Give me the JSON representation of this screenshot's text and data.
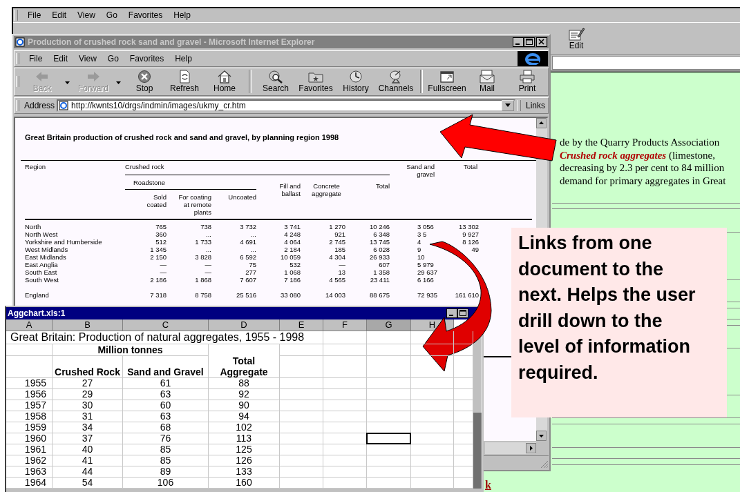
{
  "background_browser": {
    "menu": [
      {
        "label": "File"
      },
      {
        "label": "Edit"
      },
      {
        "label": "View"
      },
      {
        "label": "Go"
      },
      {
        "label": "Favorites"
      },
      {
        "label": "Help"
      }
    ],
    "toolbar": [
      {
        "label": "Edit",
        "kind": "edit"
      }
    ],
    "page_lines": [
      {
        "text": "de by the Quarry Products Association"
      },
      {
        "emphasis": "Crushed rock aggregates",
        "text": "(limestone,"
      },
      {
        "text": "decreasing by 2.3 per cent to 84 million"
      },
      {
        "text": "demand for primary aggregates in Great"
      }
    ],
    "link_fragment": "k"
  },
  "browser": {
    "title": "Production of crushed rock sand and gravel - Microsoft Internet Explorer",
    "active": false,
    "menu": [
      {
        "label": "File"
      },
      {
        "label": "Edit"
      },
      {
        "label": "View"
      },
      {
        "label": "Go"
      },
      {
        "label": "Favorites"
      },
      {
        "label": "Help"
      }
    ],
    "toolbar": [
      {
        "label": "Back",
        "kind": "back",
        "disabled": true,
        "dropdown": true,
        "separator_after": false
      },
      {
        "label": "Forward",
        "kind": "forward",
        "disabled": true,
        "dropdown": true,
        "separator_after": false
      },
      {
        "label": "Stop",
        "kind": "stop",
        "disabled": false,
        "dropdown": false,
        "separator_after": false
      },
      {
        "label": "Refresh",
        "kind": "refresh",
        "disabled": false,
        "dropdown": false,
        "separator_after": false
      },
      {
        "label": "Home",
        "kind": "home",
        "disabled": false,
        "dropdown": false,
        "separator_after": true
      },
      {
        "label": "Search",
        "kind": "search",
        "disabled": false,
        "dropdown": false,
        "separator_after": false
      },
      {
        "label": "Favorites",
        "kind": "favorites",
        "disabled": false,
        "dropdown": false,
        "separator_after": false
      },
      {
        "label": "History",
        "kind": "history",
        "disabled": false,
        "dropdown": false,
        "separator_after": false
      },
      {
        "label": "Channels",
        "kind": "channels",
        "disabled": false,
        "dropdown": false,
        "separator_after": true
      },
      {
        "label": "Fullscreen",
        "kind": "fullscreen",
        "disabled": false,
        "dropdown": false,
        "separator_after": false
      },
      {
        "label": "Mail",
        "kind": "mail",
        "disabled": false,
        "dropdown": false,
        "separator_after": false
      },
      {
        "label": "Print",
        "kind": "print",
        "disabled": false,
        "dropdown": false,
        "separator_after": false
      }
    ],
    "address_label": "Address",
    "url": "http://kwnts10/drgs/indmin/images/ukmy_cr.htm",
    "links_label": "Links",
    "table": {
      "heading": "Great Britain production of crushed rock and sand and gravel, by planning region 1998",
      "headers": {
        "region": "Region",
        "crushed_rock": "Crushed rock",
        "roadstone": "Roadstone",
        "sold_coated": "Sold coated",
        "for_coating": "For coating at remote plants",
        "uncoated": "Uncoated",
        "fill": "Fill and ballast",
        "concrete": "Concrete aggregate",
        "crushed_total": "Total",
        "sand": "Sand and gravel",
        "total": "Total"
      },
      "rows": [
        {
          "kind": "region",
          "region": "North",
          "values": [
            "765",
            "738",
            "3 732",
            "3 741",
            "1 270",
            "10 246",
            "3 056",
            "13 302"
          ]
        },
        {
          "kind": "region",
          "region": "North West",
          "values": [
            "360",
            "...",
            "...",
            "4 248",
            "921",
            "6 348",
            "3 5",
            "9 927"
          ]
        },
        {
          "kind": "region",
          "region": "Yorkshire and Humberside",
          "values": [
            "512",
            "1 733",
            "4 691",
            "4 064",
            "2 745",
            "13 745",
            "4",
            "8 126"
          ]
        },
        {
          "kind": "region",
          "region": "West Midlands",
          "values": [
            "1 345",
            "...",
            "...",
            "2 184",
            "185",
            "6 028",
            "9",
            "49"
          ]
        },
        {
          "kind": "region",
          "region": "East Midlands",
          "values": [
            "2 150",
            "3 828",
            "6 592",
            "10 059",
            "4 304",
            "26 933",
            "10"
          ]
        },
        {
          "kind": "region",
          "region": "East Anglia",
          "values": [
            "—",
            "—",
            "75",
            "532",
            "—",
            "607",
            "5 979"
          ]
        },
        {
          "kind": "region",
          "region": "South East",
          "values": [
            "—",
            "—",
            "277",
            "1 068",
            "13",
            "1 358",
            "29 637"
          ]
        },
        {
          "kind": "region",
          "region": "South West",
          "values": [
            "2 186",
            "1 868",
            "7 607",
            "7 186",
            "4 565",
            "23 411",
            "6 166"
          ]
        },
        {
          "kind": "total",
          "region": "England",
          "values": [
            "7 318",
            "8 758",
            "25 516",
            "33 080",
            "14 003",
            "88 675",
            "72 935",
            "161 610"
          ]
        }
      ]
    }
  },
  "spreadsheet": {
    "title": "Aggchart.xls:1",
    "active": true,
    "columns": [
      {
        "label": "A",
        "selected": false
      },
      {
        "label": "B",
        "selected": false
      },
      {
        "label": "C",
        "selected": false
      },
      {
        "label": "D",
        "selected": false
      },
      {
        "label": "E",
        "selected": false
      },
      {
        "label": "F",
        "selected": false
      },
      {
        "label": "G",
        "selected": true
      },
      {
        "label": "H",
        "selected": false
      }
    ],
    "title_cell": "Great Britain: Production of natural aggregates, 1955 - 1998",
    "group_header": "Million tonnes",
    "headers": [
      "Crushed Rock",
      "Sand and Gravel",
      "Total Aggregate"
    ],
    "rows": [
      {
        "cells": [
          "1955",
          "27",
          "61",
          "88"
        ],
        "selected": false
      },
      {
        "cells": [
          "1956",
          "29",
          "63",
          "92"
        ],
        "selected": false
      },
      {
        "cells": [
          "1957",
          "30",
          "60",
          "90"
        ],
        "selected": false
      },
      {
        "cells": [
          "1958",
          "31",
          "63",
          "94"
        ],
        "selected": false
      },
      {
        "cells": [
          "1959",
          "34",
          "68",
          "102"
        ],
        "selected": false
      },
      {
        "cells": [
          "1960",
          "37",
          "76",
          "113"
        ],
        "selected": true
      },
      {
        "cells": [
          "1961",
          "40",
          "85",
          "125"
        ],
        "selected": false
      },
      {
        "cells": [
          "1962",
          "41",
          "85",
          "126"
        ],
        "selected": false
      },
      {
        "cells": [
          "1963",
          "44",
          "89",
          "133"
        ],
        "selected": false
      },
      {
        "cells": [
          "1964",
          "54",
          "106",
          "160"
        ],
        "selected": false
      }
    ]
  },
  "callout": {
    "text": "Links from one document to the next. Helps the user drill down to the level of information required."
  }
}
